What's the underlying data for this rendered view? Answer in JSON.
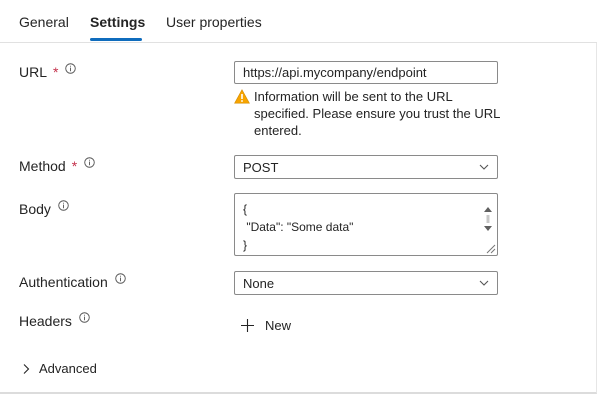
{
  "tabs": [
    {
      "label": "General"
    },
    {
      "label": "Settings"
    },
    {
      "label": "User properties"
    }
  ],
  "form": {
    "url": {
      "label": "URL",
      "required_mark": "*",
      "value": "https://api.mycompany/endpoint",
      "warning_line1": "Information will be sent to the URL",
      "warning_line2": "specified. Please ensure you trust the URL",
      "warning_line3": "entered."
    },
    "method": {
      "label": "Method",
      "required_mark": "*",
      "selected": "POST"
    },
    "body": {
      "label": "Body",
      "value": "{\n \"Data\": \"Some data\"\n}"
    },
    "authentication": {
      "label": "Authentication",
      "selected": "None"
    },
    "headers": {
      "label": "Headers",
      "new_label": "New"
    },
    "advanced": {
      "label": "Advanced"
    }
  },
  "colors": {
    "accent": "#0f6cbd",
    "required": "#c4314b",
    "warning": "#f7a400"
  },
  "icons": {
    "info": "info-icon",
    "warning": "warning-icon",
    "chevron": "chevron-down-icon",
    "plus": "plus-icon",
    "expand": "chevron-right-icon"
  }
}
